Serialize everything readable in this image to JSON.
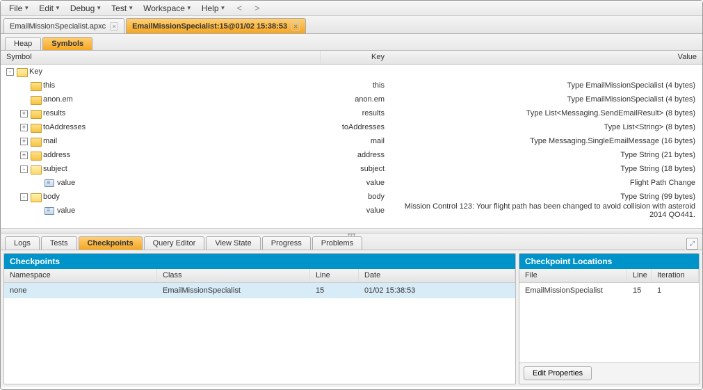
{
  "menu": [
    "File",
    "Edit",
    "Debug",
    "Test",
    "Workspace",
    "Help"
  ],
  "nav": {
    "back": "<",
    "fwd": ">"
  },
  "fileTabs": [
    {
      "label": "EmailMissionSpecialist.apxc",
      "active": false
    },
    {
      "label": "EmailMissionSpecialist:15@01/02 15:38:53",
      "active": true
    }
  ],
  "subTabs": [
    {
      "label": "Heap",
      "active": false
    },
    {
      "label": "Symbols",
      "active": true
    }
  ],
  "treeCols": {
    "symbol": "Symbol",
    "key": "Key",
    "value": "Value"
  },
  "tree": [
    {
      "indent": 0,
      "exp": "-",
      "icon": "folder-open",
      "symbol": "Key",
      "key": "",
      "value": ""
    },
    {
      "indent": 1,
      "exp": "",
      "icon": "folder",
      "symbol": "this",
      "key": "this",
      "value": "Type EmailMissionSpecialist (4 bytes)"
    },
    {
      "indent": 1,
      "exp": "",
      "icon": "folder",
      "symbol": "anon.em",
      "key": "anon.em",
      "value": "Type EmailMissionSpecialist (4 bytes)"
    },
    {
      "indent": 1,
      "exp": "+",
      "icon": "folder",
      "symbol": "results",
      "key": "results",
      "value": "Type List<Messaging.SendEmailResult> (8 bytes)"
    },
    {
      "indent": 1,
      "exp": "+",
      "icon": "folder",
      "symbol": "toAddresses",
      "key": "toAddresses",
      "value": "Type List<String> (8 bytes)"
    },
    {
      "indent": 1,
      "exp": "+",
      "icon": "folder",
      "symbol": "mail",
      "key": "mail",
      "value": "Type Messaging.SingleEmailMessage (16 bytes)"
    },
    {
      "indent": 1,
      "exp": "+",
      "icon": "folder",
      "symbol": "address",
      "key": "address",
      "value": "Type String (21 bytes)"
    },
    {
      "indent": 1,
      "exp": "-",
      "icon": "folder-open",
      "symbol": "subject",
      "key": "subject",
      "value": "Type String (18 bytes)"
    },
    {
      "indent": 2,
      "exp": "",
      "icon": "value",
      "symbol": "value",
      "key": "value",
      "value": "Flight Path Change"
    },
    {
      "indent": 1,
      "exp": "-",
      "icon": "folder-open",
      "symbol": "body",
      "key": "body",
      "value": "Type String (99 bytes)"
    },
    {
      "indent": 2,
      "exp": "",
      "icon": "value",
      "symbol": "value",
      "key": "value",
      "value": "Mission Control 123: Your flight path has been changed to avoid collision with asteroid 2014 QO441."
    }
  ],
  "bottomTabs": [
    "Logs",
    "Tests",
    "Checkpoints",
    "Query Editor",
    "View State",
    "Progress",
    "Problems"
  ],
  "bottomActive": "Checkpoints",
  "checkpoints": {
    "title": "Checkpoints",
    "cols": {
      "ns": "Namespace",
      "cls": "Class",
      "line": "Line",
      "date": "Date"
    },
    "rows": [
      {
        "ns": "none",
        "cls": "EmailMissionSpecialist",
        "line": "15",
        "date": "01/02 15:38:53"
      }
    ]
  },
  "locations": {
    "title": "Checkpoint Locations",
    "cols": {
      "file": "File",
      "line": "Line",
      "iter": "Iteration"
    },
    "rows": [
      {
        "file": "EmailMissionSpecialist",
        "line": "15",
        "iter": "1"
      }
    ],
    "editBtn": "Edit Properties"
  }
}
